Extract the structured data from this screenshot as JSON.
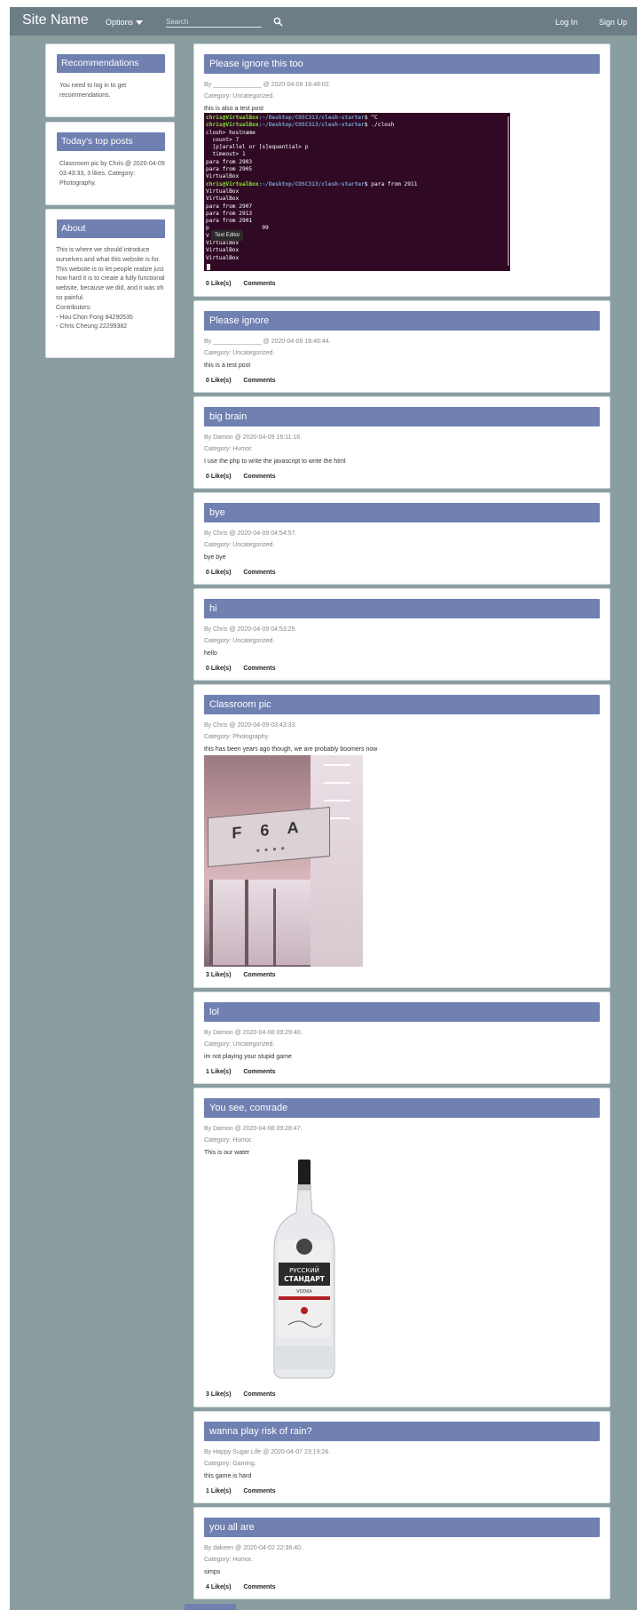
{
  "navbar": {
    "brand": "Site Name",
    "options_label": "Options",
    "search_placeholder": "Search",
    "search_icon": "search-icon",
    "login_label": "Log In",
    "signup_label": "Sign Up"
  },
  "sidebar": {
    "recommendations": {
      "title": "Recommendations",
      "text": "You need to log in to get recommendations."
    },
    "top_posts": {
      "title": "Today's top posts",
      "text": "Classroom pic by Chris @ 2020-04-09 03:43:33, 3 likes. Category: Photography."
    },
    "about": {
      "title": "About",
      "text": "This is where we should introduce ourselves and what this website is for.",
      "text2": "This website is to let people realize just how hard it is to create a fully functional website, because we did, and it was oh so painful.",
      "contributors_label": "Contributors:",
      "contributor1": "- Hou Chon Fong 84290535",
      "contributor2": "- Chris Cheung 22299382"
    }
  },
  "posts": [
    {
      "title": "Please ignore this too",
      "meta": "By ______________ @ 2020-04-09 18:48:02.",
      "category": "Category: Uncategorized.",
      "body": "this is also a test post",
      "likes": "0 Like(s)",
      "comments": "Comments"
    },
    {
      "title": "Please ignore",
      "meta": "By ______________ @ 2020-04-09 18:46:44.",
      "category": "Category: Uncategorized.",
      "body": "this is a test post",
      "likes": "0 Like(s)",
      "comments": "Comments"
    },
    {
      "title": "big brain",
      "meta": "By Damon @ 2020-04-09 16:11:16.",
      "category": "Category: Humor.",
      "body": "I use the php to write the javascript to write the html",
      "likes": "0 Like(s)",
      "comments": "Comments"
    },
    {
      "title": "bye",
      "meta": "By Chris @ 2020-04-09 04:54:57.",
      "category": "Category: Uncategorized.",
      "body": "bye bye",
      "likes": "0 Like(s)",
      "comments": "Comments"
    },
    {
      "title": "hi",
      "meta": "By Chris @ 2020-04-09 04:53:25.",
      "category": "Category: Uncategorized.",
      "body": "hello",
      "likes": "0 Like(s)",
      "comments": "Comments"
    },
    {
      "title": "Classroom pic",
      "meta": "By Chris @ 2020-04-09 03:43:33.",
      "category": "Category: Photography.",
      "body": "this has been years ago though, we are probably boomers now",
      "likes": "3 Like(s)",
      "comments": "Comments",
      "image_sign": "F 6 A"
    },
    {
      "title": "lol",
      "meta": "By Damon @ 2020-04-08 09:29:40.",
      "category": "Category: Uncategorized.",
      "body": "im not playing your stupid game",
      "likes": "1 Like(s)",
      "comments": "Comments"
    },
    {
      "title": "You see, comrade",
      "meta": "By Damon @ 2020-04-08 09:28:47.",
      "category": "Category: Humor.",
      "body": "This is our water",
      "likes": "3 Like(s)",
      "comments": "Comments",
      "bottle_label1": "РУССКИЙ",
      "bottle_label2": "СТАНДАРТ",
      "bottle_label3": "VODKA"
    },
    {
      "title": "wanna play risk of rain?",
      "meta": "By Happy Sugar Life @ 2020-04-07 23:19:28.",
      "category": "Category: Gaming.",
      "body": "this game is hard",
      "likes": "1 Like(s)",
      "comments": "Comments"
    },
    {
      "title": "you all are",
      "meta": "By dakeen @ 2020-04-02 22:36:40.",
      "category": "Category: Humor.",
      "body": "simps",
      "likes": "4 Like(s)",
      "comments": "Comments"
    }
  ],
  "terminal": {
    "prompt_user": "chris@VirtualBox",
    "prompt_path": ":~/Desktop/COSC313/clesh-starter",
    "line1_cmd": "$ ^C",
    "line2_cmd": "$ ./closh",
    "line3": "closh> hostname",
    "line4": "  count> 7",
    "line5": "  [p]arallel or [s]equential> p",
    "line6": "  timeout> 1",
    "line7": "para from 2903",
    "line8": "para from 2905",
    "line9": "VirtualBox",
    "line10_cmd": "$ para from 2911",
    "line11": "VirtualBox",
    "line12": "VirtualBox",
    "line13": "para from 2907",
    "line14": "para from 2913",
    "line15": "para from 2901",
    "line16": "p                09",
    "line17": "V",
    "line18": "VirtualBox",
    "line19": "VirtualBox",
    "line20": "VirtualBox",
    "tooltip": "Text Editor"
  }
}
